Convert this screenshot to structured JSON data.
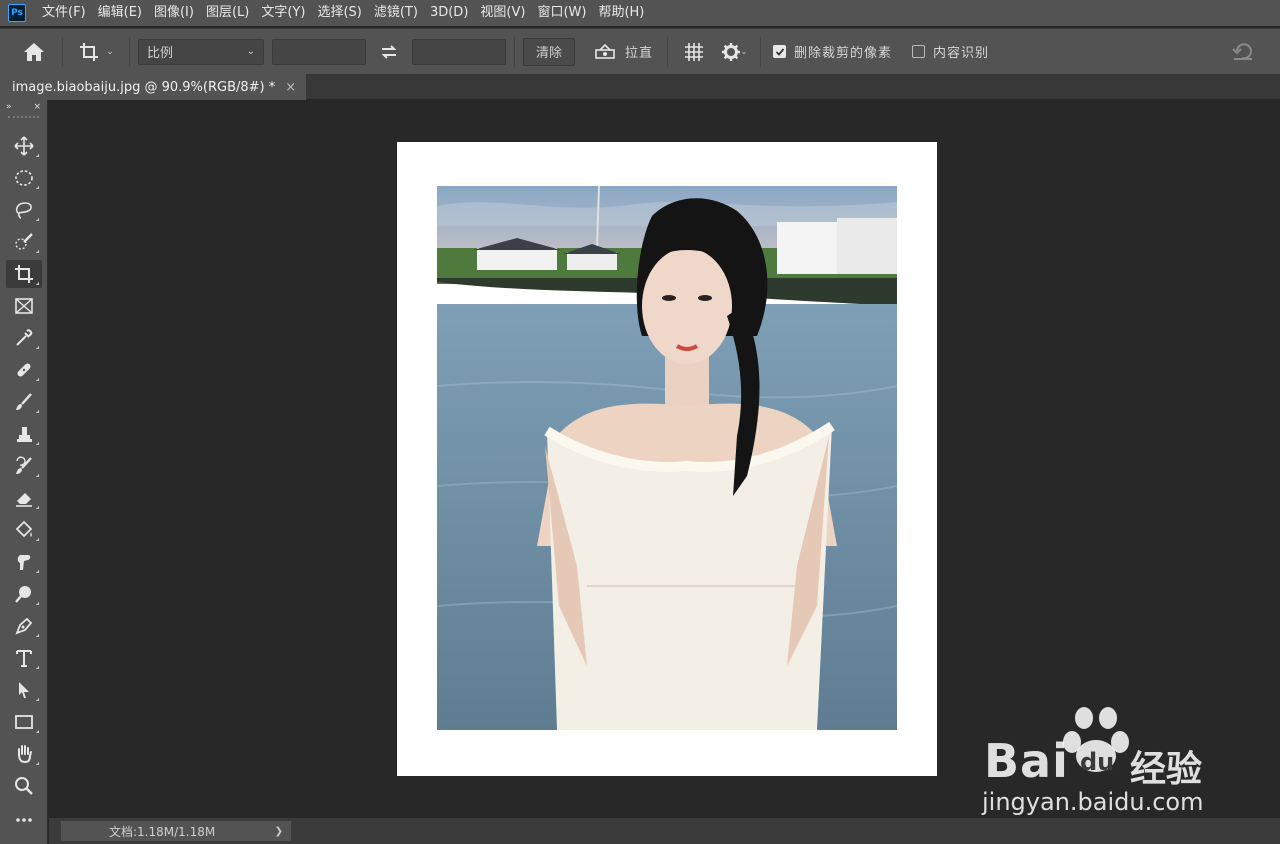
{
  "menubar": {
    "logo": "Ps",
    "items": [
      "文件(F)",
      "编辑(E)",
      "图像(I)",
      "图层(L)",
      "文字(Y)",
      "选择(S)",
      "滤镜(T)",
      "3D(D)",
      "视图(V)",
      "窗口(W)",
      "帮助(H)"
    ]
  },
  "options": {
    "ratio_label": "比例",
    "width_value": "",
    "height_value": "",
    "clear_label": "清除",
    "straighten_label": "拉直",
    "delete_cropped_label": "删除裁剪的像素",
    "delete_cropped_checked": true,
    "content_aware_label": "内容识别",
    "content_aware_checked": false
  },
  "tab": {
    "title": "image.biaobaiju.jpg @ 90.9%(RGB/8#) *",
    "close": "×"
  },
  "toolbar": {
    "collapse": "»",
    "close": "×",
    "tools": [
      "move-tool",
      "marquee-tool",
      "lasso-tool",
      "quick-selection-tool",
      "crop-tool",
      "frame-tool",
      "eyedropper-tool",
      "healing-brush-tool",
      "brush-tool",
      "clone-stamp-tool",
      "history-brush-tool",
      "eraser-tool",
      "paint-bucket-tool",
      "smudge-tool",
      "dodge-tool",
      "pen-tool",
      "type-tool",
      "path-selection-tool",
      "rectangle-tool",
      "hand-tool",
      "zoom-tool",
      "more-tools"
    ],
    "active_tool": "crop-tool"
  },
  "status": {
    "doc_info": "文档:1.18M/1.18M",
    "arrow": "❯"
  },
  "watermark": {
    "brand": "Bai",
    "du": "du",
    "cn": "经验",
    "url": "jingyan.baidu.com"
  },
  "colors": {
    "ui_panel": "#535353",
    "canvas_bg": "#282828",
    "accent": "#31a8ff"
  }
}
